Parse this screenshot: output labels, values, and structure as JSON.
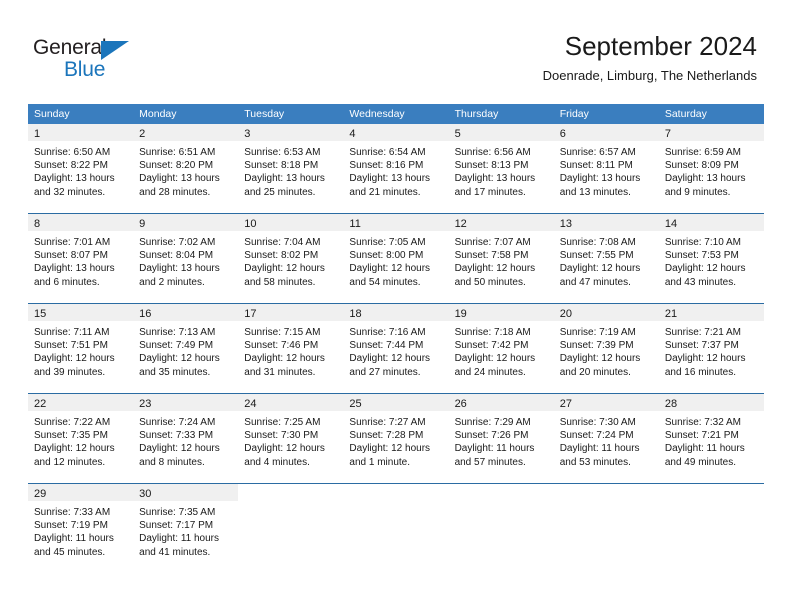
{
  "brand": {
    "name_top": "General",
    "name_bottom": "Blue",
    "triangle_icon": "triangle-icon",
    "color_dark": "#231f20",
    "color_blue": "#1b75bb"
  },
  "header": {
    "title": "September 2024",
    "subtitle": "Doenrade, Limburg, The Netherlands"
  },
  "theme": {
    "header_bg": "#3a7ebf",
    "header_text": "#ffffff",
    "row_divider": "#2b6ca3",
    "daynum_band_bg": "#f0f0f0",
    "cell_bg": "#ffffff",
    "text": "#1a1a1a"
  },
  "weekday_headers": [
    "Sunday",
    "Monday",
    "Tuesday",
    "Wednesday",
    "Thursday",
    "Friday",
    "Saturday"
  ],
  "weeks": [
    [
      {
        "day": "1",
        "lines": [
          "Sunrise: 6:50 AM",
          "Sunset: 8:22 PM",
          "Daylight: 13 hours",
          "and 32 minutes."
        ]
      },
      {
        "day": "2",
        "lines": [
          "Sunrise: 6:51 AM",
          "Sunset: 8:20 PM",
          "Daylight: 13 hours",
          "and 28 minutes."
        ]
      },
      {
        "day": "3",
        "lines": [
          "Sunrise: 6:53 AM",
          "Sunset: 8:18 PM",
          "Daylight: 13 hours",
          "and 25 minutes."
        ]
      },
      {
        "day": "4",
        "lines": [
          "Sunrise: 6:54 AM",
          "Sunset: 8:16 PM",
          "Daylight: 13 hours",
          "and 21 minutes."
        ]
      },
      {
        "day": "5",
        "lines": [
          "Sunrise: 6:56 AM",
          "Sunset: 8:13 PM",
          "Daylight: 13 hours",
          "and 17 minutes."
        ]
      },
      {
        "day": "6",
        "lines": [
          "Sunrise: 6:57 AM",
          "Sunset: 8:11 PM",
          "Daylight: 13 hours",
          "and 13 minutes."
        ]
      },
      {
        "day": "7",
        "lines": [
          "Sunrise: 6:59 AM",
          "Sunset: 8:09 PM",
          "Daylight: 13 hours",
          "and 9 minutes."
        ]
      }
    ],
    [
      {
        "day": "8",
        "lines": [
          "Sunrise: 7:01 AM",
          "Sunset: 8:07 PM",
          "Daylight: 13 hours",
          "and 6 minutes."
        ]
      },
      {
        "day": "9",
        "lines": [
          "Sunrise: 7:02 AM",
          "Sunset: 8:04 PM",
          "Daylight: 13 hours",
          "and 2 minutes."
        ]
      },
      {
        "day": "10",
        "lines": [
          "Sunrise: 7:04 AM",
          "Sunset: 8:02 PM",
          "Daylight: 12 hours",
          "and 58 minutes."
        ]
      },
      {
        "day": "11",
        "lines": [
          "Sunrise: 7:05 AM",
          "Sunset: 8:00 PM",
          "Daylight: 12 hours",
          "and 54 minutes."
        ]
      },
      {
        "day": "12",
        "lines": [
          "Sunrise: 7:07 AM",
          "Sunset: 7:58 PM",
          "Daylight: 12 hours",
          "and 50 minutes."
        ]
      },
      {
        "day": "13",
        "lines": [
          "Sunrise: 7:08 AM",
          "Sunset: 7:55 PM",
          "Daylight: 12 hours",
          "and 47 minutes."
        ]
      },
      {
        "day": "14",
        "lines": [
          "Sunrise: 7:10 AM",
          "Sunset: 7:53 PM",
          "Daylight: 12 hours",
          "and 43 minutes."
        ]
      }
    ],
    [
      {
        "day": "15",
        "lines": [
          "Sunrise: 7:11 AM",
          "Sunset: 7:51 PM",
          "Daylight: 12 hours",
          "and 39 minutes."
        ]
      },
      {
        "day": "16",
        "lines": [
          "Sunrise: 7:13 AM",
          "Sunset: 7:49 PM",
          "Daylight: 12 hours",
          "and 35 minutes."
        ]
      },
      {
        "day": "17",
        "lines": [
          "Sunrise: 7:15 AM",
          "Sunset: 7:46 PM",
          "Daylight: 12 hours",
          "and 31 minutes."
        ]
      },
      {
        "day": "18",
        "lines": [
          "Sunrise: 7:16 AM",
          "Sunset: 7:44 PM",
          "Daylight: 12 hours",
          "and 27 minutes."
        ]
      },
      {
        "day": "19",
        "lines": [
          "Sunrise: 7:18 AM",
          "Sunset: 7:42 PM",
          "Daylight: 12 hours",
          "and 24 minutes."
        ]
      },
      {
        "day": "20",
        "lines": [
          "Sunrise: 7:19 AM",
          "Sunset: 7:39 PM",
          "Daylight: 12 hours",
          "and 20 minutes."
        ]
      },
      {
        "day": "21",
        "lines": [
          "Sunrise: 7:21 AM",
          "Sunset: 7:37 PM",
          "Daylight: 12 hours",
          "and 16 minutes."
        ]
      }
    ],
    [
      {
        "day": "22",
        "lines": [
          "Sunrise: 7:22 AM",
          "Sunset: 7:35 PM",
          "Daylight: 12 hours",
          "and 12 minutes."
        ]
      },
      {
        "day": "23",
        "lines": [
          "Sunrise: 7:24 AM",
          "Sunset: 7:33 PM",
          "Daylight: 12 hours",
          "and 8 minutes."
        ]
      },
      {
        "day": "24",
        "lines": [
          "Sunrise: 7:25 AM",
          "Sunset: 7:30 PM",
          "Daylight: 12 hours",
          "and 4 minutes."
        ]
      },
      {
        "day": "25",
        "lines": [
          "Sunrise: 7:27 AM",
          "Sunset: 7:28 PM",
          "Daylight: 12 hours",
          "and 1 minute."
        ]
      },
      {
        "day": "26",
        "lines": [
          "Sunrise: 7:29 AM",
          "Sunset: 7:26 PM",
          "Daylight: 11 hours",
          "and 57 minutes."
        ]
      },
      {
        "day": "27",
        "lines": [
          "Sunrise: 7:30 AM",
          "Sunset: 7:24 PM",
          "Daylight: 11 hours",
          "and 53 minutes."
        ]
      },
      {
        "day": "28",
        "lines": [
          "Sunrise: 7:32 AM",
          "Sunset: 7:21 PM",
          "Daylight: 11 hours",
          "and 49 minutes."
        ]
      }
    ],
    [
      {
        "day": "29",
        "lines": [
          "Sunrise: 7:33 AM",
          "Sunset: 7:19 PM",
          "Daylight: 11 hours",
          "and 45 minutes."
        ]
      },
      {
        "day": "30",
        "lines": [
          "Sunrise: 7:35 AM",
          "Sunset: 7:17 PM",
          "Daylight: 11 hours",
          "and 41 minutes."
        ]
      },
      {
        "day": "",
        "lines": []
      },
      {
        "day": "",
        "lines": []
      },
      {
        "day": "",
        "lines": []
      },
      {
        "day": "",
        "lines": []
      },
      {
        "day": "",
        "lines": []
      }
    ]
  ]
}
